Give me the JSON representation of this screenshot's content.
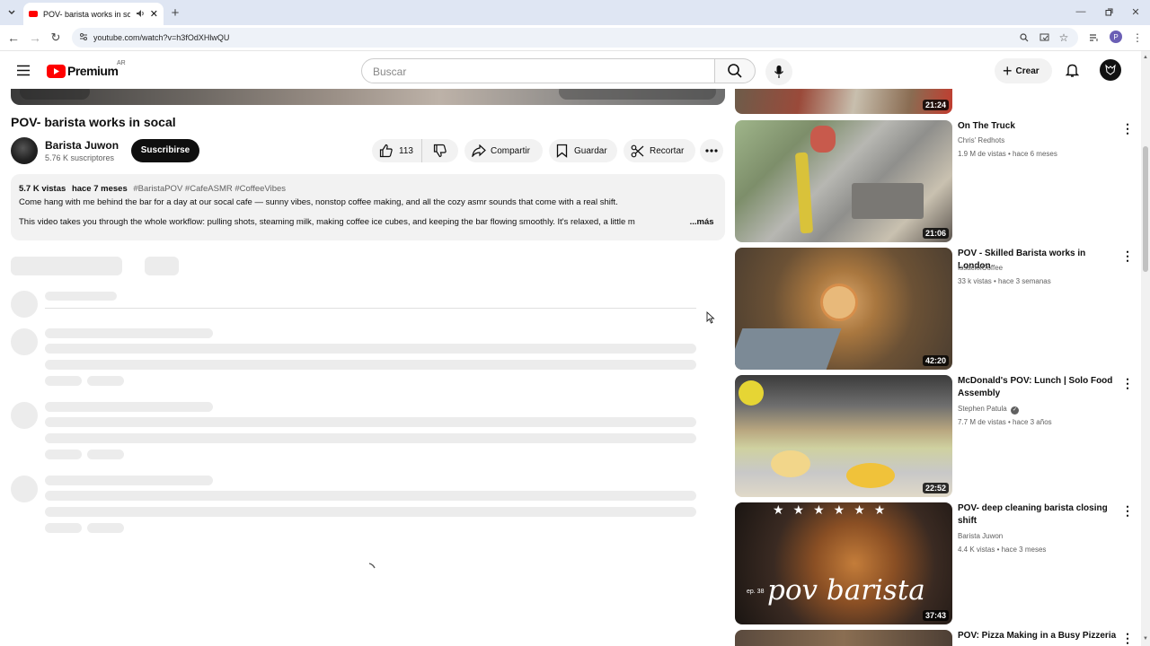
{
  "browser": {
    "tab_title": "POV- barista works in socal",
    "new_tab": "+",
    "url": "youtube.com/watch?v=h3fOdXHlwQU",
    "profile_letter": "P"
  },
  "header": {
    "logo_text": "Premium",
    "region": "AR",
    "search_placeholder": "Buscar",
    "create_label": "Crear"
  },
  "video": {
    "title": "POV- barista works in socal",
    "channel": "Barista Juwon",
    "subscribers": "5.76 K suscriptores",
    "subscribe_label": "Suscribirse",
    "likes": "113",
    "share_label": "Compartir",
    "save_label": "Guardar",
    "clip_label": "Recortar"
  },
  "description": {
    "views": "5.7 K vistas",
    "date": "hace 7 meses",
    "tags": "#BaristaPOV #CafeASMR #CoffeeVibes",
    "line1": "Come hang with me behind the bar for a day at our socal cafe — sunny vibes, nonstop coffee making, and all the cozy asmr sounds that come with a real shift.",
    "line2": "This video takes you through the whole workflow: pulling shots, steaming milk, making coffee ice cubes, and keeping the bar flowing smoothly. It's relaxed, a little m",
    "more": "...más"
  },
  "recommendations": [
    {
      "title": "",
      "channel": "",
      "meta": "",
      "duration": "21:24"
    },
    {
      "title": "On The Truck",
      "channel": "Chris' Redhots",
      "meta": "1.9 M de vistas • hace 6 meses",
      "duration": "21:06"
    },
    {
      "title": "POV - Skilled Barista works in London",
      "channel": "IssackxCoffee",
      "meta": "33 k vistas • hace 3 semanas",
      "duration": "42:20"
    },
    {
      "title": "McDonald's POV: Lunch | Solo Food Assembly",
      "channel": "Stephen Patula",
      "meta": "7.7 M de vistas • hace 3 años",
      "duration": "22:52"
    },
    {
      "title": "POV- deep cleaning barista closing shift",
      "channel": "Barista Juwon",
      "meta": "4.4 K vistas • hace 3 meses",
      "duration": "37:43",
      "overlay": "pov barista",
      "episode": "ep. 38"
    },
    {
      "title": "POV: Pizza Making in a Busy Pizzeria",
      "channel": "",
      "meta": "",
      "duration": ""
    }
  ],
  "colors": {
    "brand": "#ff0000",
    "text": "#0f0f0f",
    "muted": "#606060",
    "skeleton": "#ececec"
  }
}
